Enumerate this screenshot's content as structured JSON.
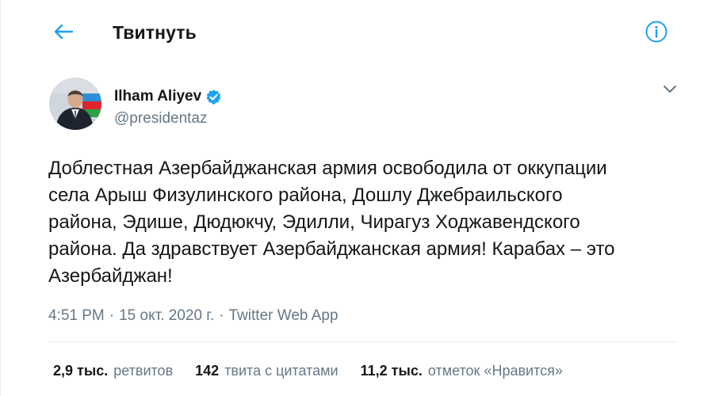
{
  "colors": {
    "accent": "#1da1f2",
    "text_primary": "#14171a",
    "text_secondary": "#657786",
    "divider": "#e6ecf0"
  },
  "header": {
    "title": "Твитнуть",
    "back_icon": "arrow-left-icon",
    "info_icon": "info-circle-icon"
  },
  "tweet": {
    "author": {
      "display_name": "Ilham Aliyev",
      "handle": "@presidentaz",
      "verified": true,
      "avatar_icon": "user-avatar"
    },
    "menu_icon": "chevron-down-icon",
    "text": "Доблестная Азербайджанская армия освободила от оккупации\nсела Арыш Физулинского района, Дошлу Джебраильского\nрайона, Эдише, Дюдюкчу, Эдилли, Чирагуз Ходжавендского\nрайона. Да здравствует Азербайджанская армия! Карабах – это\nАзербайджан!",
    "time": "4:51 PM",
    "separator": "·",
    "date": "15 окт. 2020 г.",
    "source": "Twitter Web App"
  },
  "stats": [
    {
      "count": "2,9 тыс.",
      "label": "ретвитов"
    },
    {
      "count": "142",
      "label": "твита с цитатами"
    },
    {
      "count": "11,2 тыс.",
      "label": "отметок «Нравится»"
    }
  ]
}
